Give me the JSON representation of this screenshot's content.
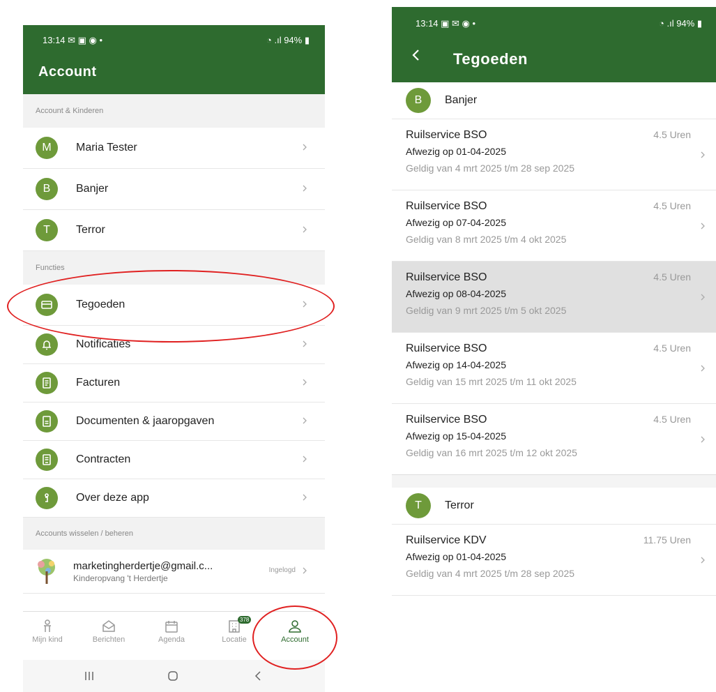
{
  "left": {
    "status": {
      "time": "13:14 ✉ ▣ ◉  •",
      "battery": "◔ .ıl 94% ▮"
    },
    "title": "Account",
    "sections": {
      "account": "Account & Kinderen",
      "functions": "Functies",
      "switch": "Accounts wisselen / beheren"
    },
    "people": [
      {
        "initial": "M",
        "name": "Maria Tester"
      },
      {
        "initial": "B",
        "name": "Banjer"
      },
      {
        "initial": "T",
        "name": "Terror"
      }
    ],
    "functions": [
      {
        "label": "Tegoeden",
        "icon": "card-icon"
      },
      {
        "label": "Notificaties",
        "icon": "bell-icon"
      },
      {
        "label": "Facturen",
        "icon": "invoice-icon"
      },
      {
        "label": "Documenten &  jaaropgaven",
        "icon": "document-icon"
      },
      {
        "label": "Contracten",
        "icon": "contract-icon"
      },
      {
        "label": "Over deze app",
        "icon": "info-icon"
      }
    ],
    "account_entry": {
      "email": "marketingherdertje@gmail.c...",
      "org": "Kinderopvang 't Herdertje",
      "state": "Ingelogd",
      "icon": "tree-logo-icon"
    },
    "nav": [
      {
        "label": "Mijn kind",
        "icon": "child-icon"
      },
      {
        "label": "Berichten",
        "icon": "message-icon"
      },
      {
        "label": "Agenda",
        "icon": "calendar-icon"
      },
      {
        "label": "Locatie",
        "icon": "building-icon",
        "badge": "378"
      },
      {
        "label": "Account",
        "icon": "person-icon",
        "active": true
      }
    ]
  },
  "right": {
    "status": {
      "time": "13:14 ▣ ✉ ◉  •",
      "battery": "◔ .ıl 94% ▮"
    },
    "title": "Tegoeden",
    "groups": [
      {
        "initial": "B",
        "name": "Banjer",
        "items": [
          {
            "title": "Ruilservice BSO",
            "hours": "4.5 Uren",
            "absent": "Afwezig op 01-04-2025",
            "valid": "Geldig van 4 mrt 2025 t/m 28 sep 2025"
          },
          {
            "title": "Ruilservice BSO",
            "hours": "4.5 Uren",
            "absent": "Afwezig op 07-04-2025",
            "valid": "Geldig van 8 mrt 2025 t/m 4 okt 2025"
          },
          {
            "title": "Ruilservice BSO",
            "hours": "4.5 Uren",
            "absent": "Afwezig op 08-04-2025",
            "valid": "Geldig van 9 mrt 2025 t/m 5 okt 2025",
            "selected": true
          },
          {
            "title": "Ruilservice BSO",
            "hours": "4.5 Uren",
            "absent": "Afwezig op 14-04-2025",
            "valid": "Geldig van 15 mrt 2025 t/m 11 okt 2025"
          },
          {
            "title": "Ruilservice BSO",
            "hours": "4.5 Uren",
            "absent": "Afwezig op 15-04-2025",
            "valid": "Geldig van 16 mrt 2025 t/m 12 okt 2025"
          }
        ]
      },
      {
        "initial": "T",
        "name": "Terror",
        "items": [
          {
            "title": "Ruilservice KDV",
            "hours": "11.75 Uren",
            "absent": "Afwezig op 01-04-2025",
            "valid": "Geldig van 4 mrt 2025 t/m 28 sep 2025"
          }
        ]
      }
    ]
  },
  "colors": {
    "brand": "#2e6b2f",
    "avatar": "#6e9a3a",
    "highlight": "#e02020"
  }
}
